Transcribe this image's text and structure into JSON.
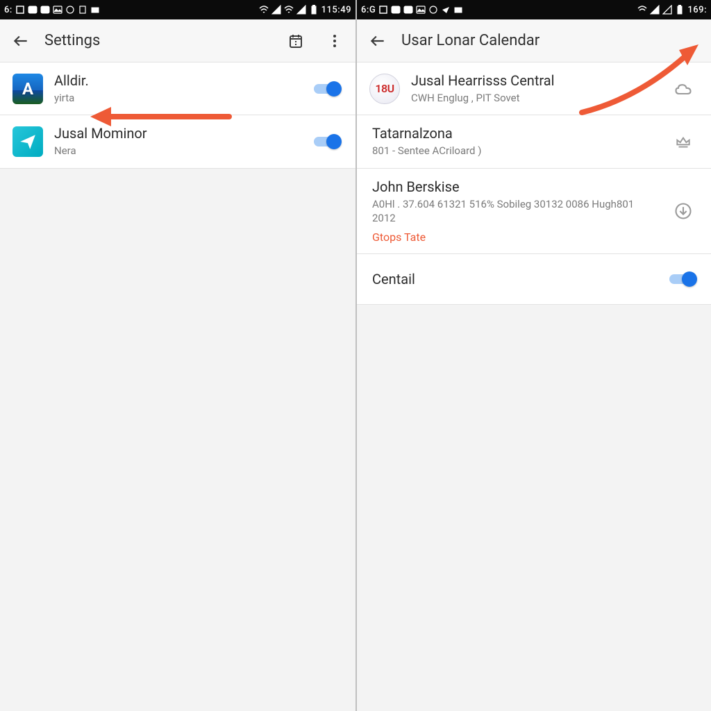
{
  "left": {
    "statusbar": {
      "left_text": "6:",
      "time": "115:49"
    },
    "appbar": {
      "title": "Settings"
    },
    "rows": [
      {
        "title": "Alldir.",
        "subtitle": "yirta"
      },
      {
        "title": "Jusal Mominor",
        "subtitle": "Nera"
      }
    ]
  },
  "right": {
    "statusbar": {
      "left_text": "6:G",
      "time": "169:"
    },
    "appbar": {
      "title": "Usar Lonar Calendar"
    },
    "rows": [
      {
        "title": "Jusal Hearrisss Central",
        "subtitle": "CWH Englug , PIT Sovet",
        "badge": "18U"
      },
      {
        "title": "Tatarnalzona",
        "subtitle": "801 - Sentee  ACriloard )"
      },
      {
        "title": "John Berskise",
        "subtitle": "A0Hl . 37.604 61321  516%  Sobileg  30132 0086 Hugh801  2012",
        "link": "Gtops Tate"
      },
      {
        "title": "Centail"
      }
    ]
  }
}
